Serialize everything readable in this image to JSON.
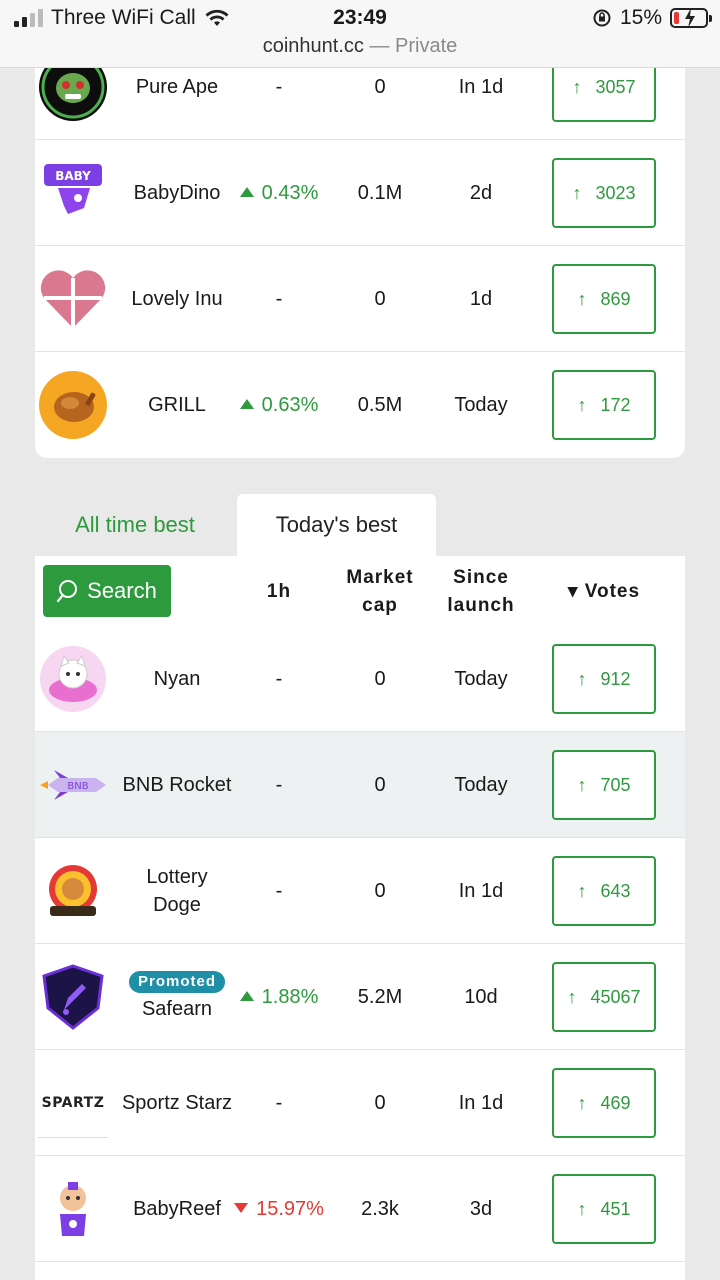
{
  "status_bar": {
    "carrier": "Three WiFi Call",
    "time": "23:49",
    "battery": "15%",
    "battery_level": 0.15
  },
  "browser": {
    "domain": "coinhunt.cc",
    "mode": "— Private"
  },
  "top_list": [
    {
      "name": "Pure Ape",
      "change": "-",
      "trend": "none",
      "market_cap": "0",
      "since_launch": "In 1d",
      "votes": "3057"
    },
    {
      "name": "BabyDino",
      "change": "0.43%",
      "trend": "up",
      "market_cap": "0.1M",
      "since_launch": "2d",
      "votes": "3023"
    },
    {
      "name": "Lovely Inu",
      "change": "-",
      "trend": "none",
      "market_cap": "0",
      "since_launch": "1d",
      "votes": "869"
    },
    {
      "name": "GRILL",
      "change": "0.63%",
      "trend": "up",
      "market_cap": "0.5M",
      "since_launch": "Today",
      "votes": "172"
    }
  ],
  "tabs": {
    "all_time": "All time best",
    "today": "Today's best"
  },
  "table_header": {
    "search": "Search",
    "col_1h": "1h",
    "col_market_cap_1": "Market",
    "col_market_cap_2": "cap",
    "col_since_1": "Since",
    "col_since_2": "launch",
    "col_votes": "▾ Votes"
  },
  "today_list": [
    {
      "name": "Nyan",
      "change": "-",
      "trend": "none",
      "market_cap": "0",
      "since_launch": "Today",
      "votes": "912"
    },
    {
      "name": "BNB Rocket",
      "change": "-",
      "trend": "none",
      "market_cap": "0",
      "since_launch": "Today",
      "votes": "705"
    },
    {
      "name_line1": "Lottery",
      "name_line2": "Doge",
      "change": "-",
      "trend": "none",
      "market_cap": "0",
      "since_launch": "In 1d",
      "votes": "643"
    },
    {
      "badge": "Promoted",
      "name": "Safearn",
      "change": "1.88%",
      "trend": "up",
      "market_cap": "5.2M",
      "since_launch": "10d",
      "votes": "45067"
    },
    {
      "name": "Sportz Starz",
      "change": "-",
      "trend": "none",
      "market_cap": "0",
      "since_launch": "In 1d",
      "votes": "469",
      "logo_text": "SPARTZ"
    },
    {
      "name": "BabyReef",
      "change": "15.97%",
      "trend": "down",
      "market_cap": "2.3k",
      "since_launch": "3d",
      "votes": "451"
    }
  ],
  "colors": {
    "accent": "#2e9a3e",
    "negative": "#e53935",
    "badge": "#1f8fa8",
    "page_bg": "#e9e9e9"
  }
}
